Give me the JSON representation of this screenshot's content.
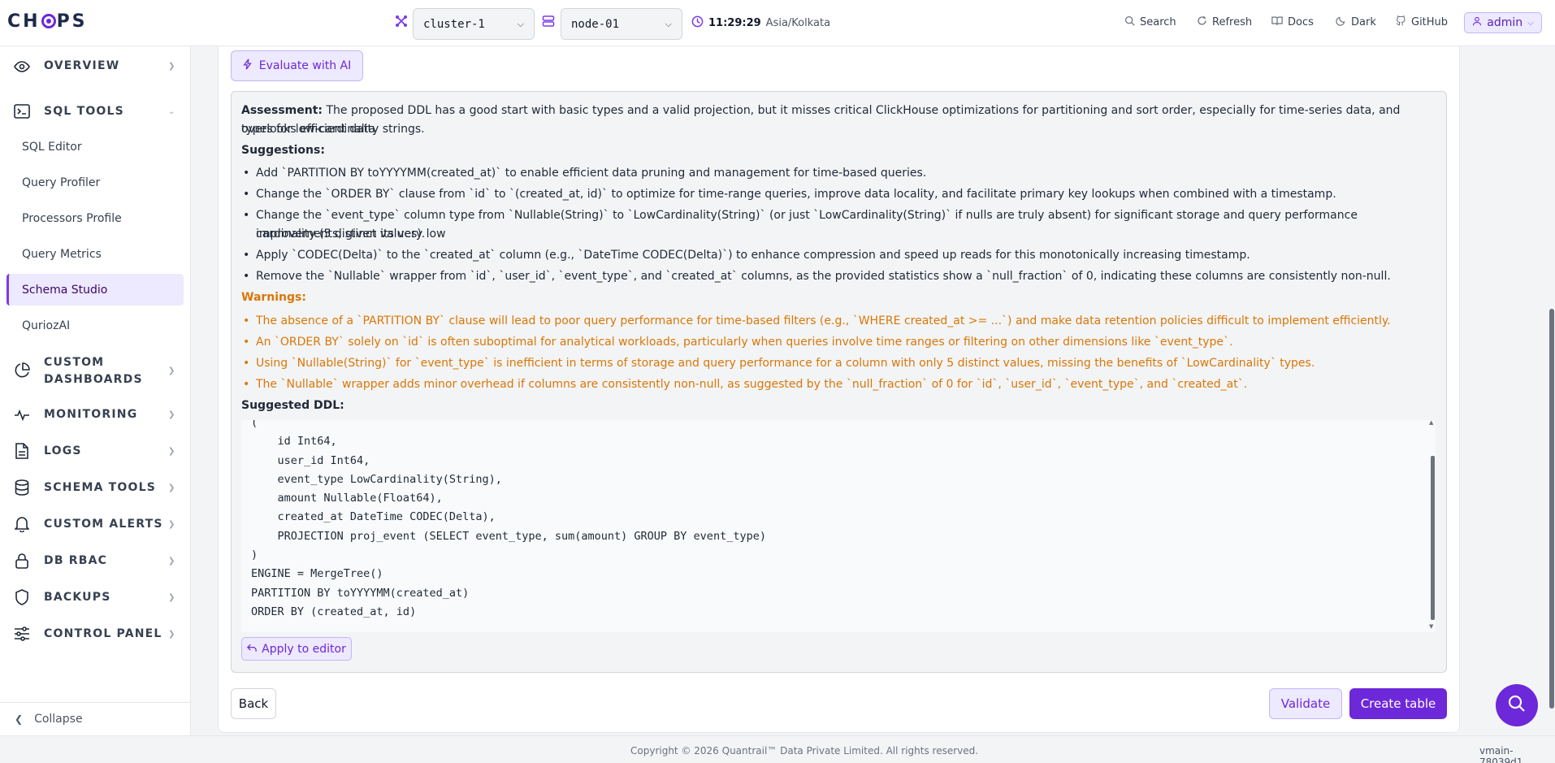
{
  "header": {
    "cluster": "cluster-1",
    "node": "node-01",
    "time": "11:29:29",
    "timezone": "Asia/Kolkata",
    "search": "Search",
    "refresh": "Refresh",
    "docs": "Docs",
    "dark": "Dark",
    "github": "GitHub",
    "user": "admin"
  },
  "sidebar": {
    "sections": {
      "overview": "OVERVIEW",
      "sql_tools": "SQL TOOLS",
      "custom_dashboards": "CUSTOM DASHBOARDS",
      "monitoring": "MONITORING",
      "logs": "LOGS",
      "schema_tools": "SCHEMA TOOLS",
      "custom_alerts": "CUSTOM ALERTS",
      "db_rbac": "DB RBAC",
      "backups": "BACKUPS",
      "control_panel": "CONTROL PANEL"
    },
    "sql_items": [
      "SQL Editor",
      "Query Profiler",
      "Processors Profile",
      "Query Metrics",
      "Schema Studio",
      "QuriozAI"
    ],
    "active": "Schema Studio",
    "collapse": "Collapse"
  },
  "main": {
    "evaluate_button": "Evaluate with AI",
    "assessment_label": "Assessment:",
    "assessment_text": "The proposed DDL has a good start with basic types and a valid projection, but it misses critical ClickHouse optimizations for partitioning and sort order, especially for time-series data, and overlooks efficient data",
    "assessment_text_2": "types for low-cardinality strings.",
    "suggestions_label": "Suggestions:",
    "suggestions": [
      "Add `PARTITION BY toYYYYMM(created_at)` to enable efficient data pruning and management for time-based queries.",
      "Change the `ORDER BY` clause from `id` to `(created_at, id)` to optimize for time-range queries, improve data locality, and facilitate primary key lookups when combined with a timestamp.",
      "Change the `event_type` column type from `Nullable(String)` to `LowCardinality(String)` (or just `LowCardinality(String)` if nulls are truly absent) for significant storage and query performance improvements, given its very low",
      "cardinality (5 distinct values).",
      "Apply `CODEC(Delta)` to the `created_at` column (e.g., `DateTime CODEC(Delta)`) to enhance compression and speed up reads for this monotonically increasing timestamp.",
      "Remove the `Nullable` wrapper from `id`, `user_id`, `event_type`, and `created_at` columns, as the provided statistics show a `null_fraction` of 0, indicating these columns are consistently non-null."
    ],
    "warnings_label": "Warnings:",
    "warnings": [
      "The absence of a `PARTITION BY` clause will lead to poor query performance for time-based filters (e.g., `WHERE created_at >= ...`) and make data retention policies difficult to implement efficiently.",
      "An `ORDER BY` solely on `id` is often suboptimal for analytical workloads, particularly when queries involve time ranges or filtering on other dimensions like `event_type`.",
      "Using `Nullable(String)` for `event_type` is inefficient in terms of storage and query performance for a column with only 5 distinct values, missing the benefits of `LowCardinality` types.",
      "The `Nullable` wrapper adds minor overhead if columns are consistently non-null, as suggested by the `null_fraction` of 0 for `id`, `user_id`, `event_type`, and `created_at`."
    ],
    "ddl_label": "Suggested DDL:",
    "ddl": "(\n    id Int64,\n    user_id Int64,\n    event_type LowCardinality(String),\n    amount Nullable(Float64),\n    created_at DateTime CODEC(Delta),\n    PROJECTION proj_event (SELECT event_type, sum(amount) GROUP BY event_type)\n)\nENGINE = MergeTree()\nPARTITION BY toYYYYMM(created_at)\nORDER BY (created_at, id)",
    "apply_button": "Apply to editor",
    "back_button": "Back",
    "validate_button": "Validate",
    "create_button": "Create table"
  },
  "footer": {
    "copyright": "Copyright © 2026 Quantrail™ Data Private Limited. All rights reserved.",
    "version": "vmain-78039d1"
  }
}
